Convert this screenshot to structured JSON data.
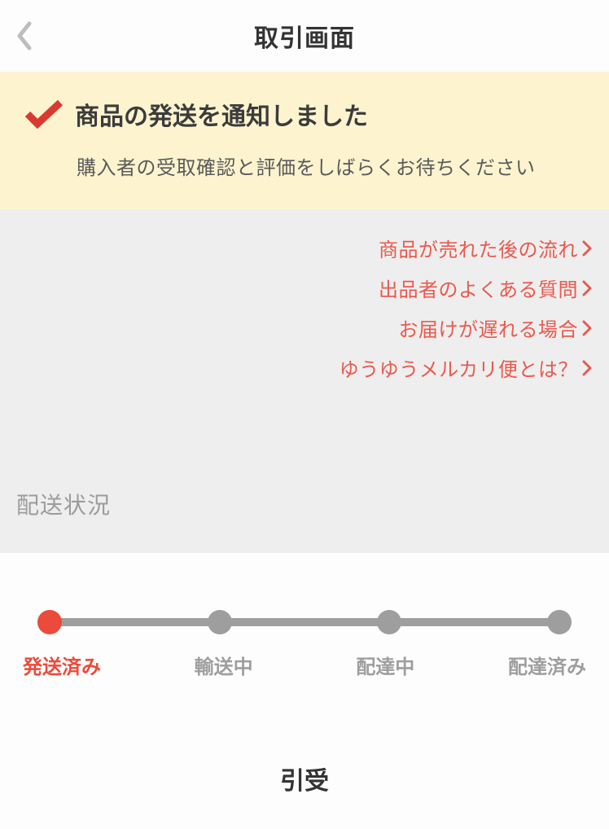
{
  "header": {
    "title": "取引画面"
  },
  "banner": {
    "title": "商品の発送を通知しました",
    "subtitle": "購入者の受取確認と評価をしばらくお待ちください"
  },
  "help_links": [
    "商品が売れた後の流れ",
    "出品者のよくある質問",
    "お届けが遅れる場合",
    "ゆうゆうメルカリ便とは？"
  ],
  "section_label": "配送状況",
  "progress": {
    "steps": [
      "発送済み",
      "輸送中",
      "配達中",
      "配達済み"
    ],
    "active_index": 0
  },
  "footer_title": "引受",
  "colors": {
    "accent": "#ea4b3a",
    "link": "#e85a4f",
    "banner_bg": "#fdf4cf",
    "gray_bg": "#eeeeee",
    "muted": "#9e9e9e"
  }
}
